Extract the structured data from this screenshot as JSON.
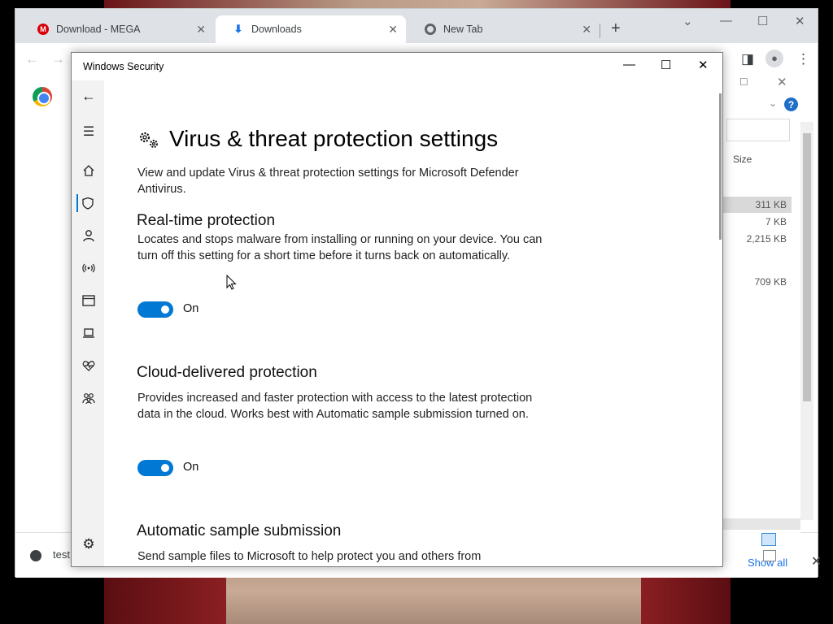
{
  "browser": {
    "tabs": [
      {
        "label": "Download - MEGA",
        "icon": "mega-icon"
      },
      {
        "label": "Downloads",
        "icon": "download-icon",
        "active": true
      },
      {
        "label": "New Tab",
        "icon": "chrome-icon"
      }
    ]
  },
  "explorer": {
    "column_header": "Size",
    "rows": [
      "311 KB",
      "7 KB",
      "2,215 KB",
      "709 KB"
    ]
  },
  "download_bar": {
    "item_label": "test",
    "show_all": "Show all"
  },
  "security_window": {
    "title": "Windows Security",
    "page_title": "Virus & threat protection settings",
    "page_description": "View and update Virus & threat protection settings for Microsoft Defender Antivirus.",
    "sections": [
      {
        "title": "Real-time protection",
        "description": "Locates and stops malware from installing or running on your device. You can turn off this setting for a short time before it turns back on automatically.",
        "toggle_label": "On"
      },
      {
        "title": "Cloud-delivered protection",
        "description": "Provides increased and faster protection with access to the latest protection data in the cloud. Works best with Automatic sample submission turned on.",
        "toggle_label": "On"
      },
      {
        "title": "Automatic sample submission",
        "description": "Send sample files to Microsoft to help protect you and others from"
      }
    ],
    "accent_color": "#0078d4"
  }
}
